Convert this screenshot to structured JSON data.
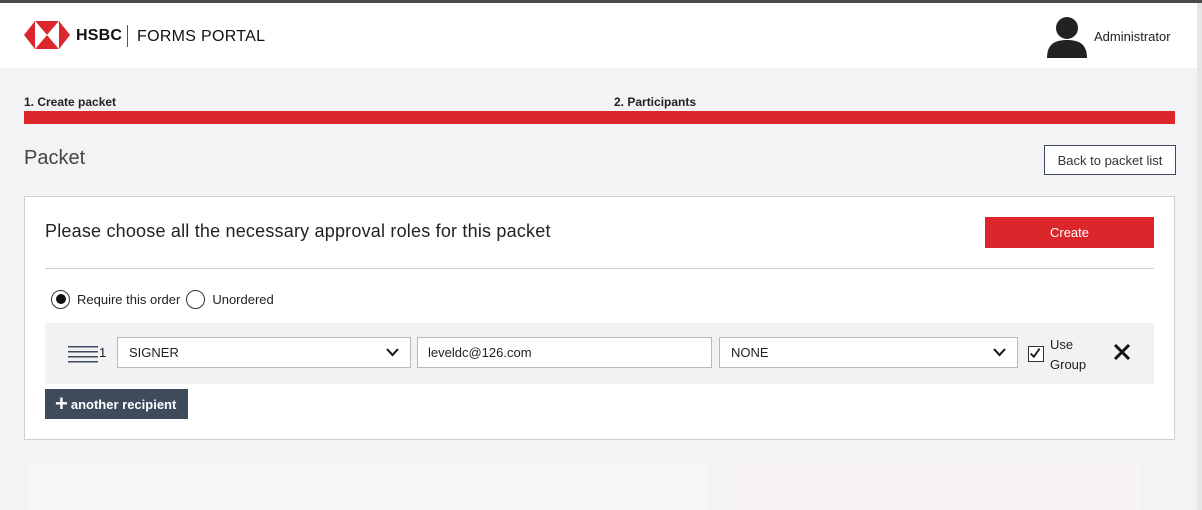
{
  "header": {
    "brand": "HSBC",
    "portal_name": "FORMS PORTAL",
    "user_name": "Administrator",
    "brand_color": "#db262c"
  },
  "steps": [
    {
      "label": "1. Create packet"
    },
    {
      "label": "2. Participants"
    }
  ],
  "page": {
    "title": "Packet",
    "back_label": "Back to packet list"
  },
  "card": {
    "title": "Please choose all the necessary approval roles for this packet",
    "create_label": "Create"
  },
  "ordering": {
    "options": [
      {
        "label": "Require this order",
        "selected": true
      },
      {
        "label": "Unordered",
        "selected": false
      }
    ]
  },
  "recipients": [
    {
      "number": "1",
      "role": "SIGNER",
      "email": "leveldc@126.com",
      "group": "NONE",
      "use_group_checked": true,
      "use_group_label": "Use Group"
    }
  ],
  "add_recipient_label": "another recipient",
  "icons": {
    "logo": "hsbc-hexagon-logo",
    "user": "user-avatar-icon",
    "drag": "drag-handle-icon",
    "chevron": "chevron-down-icon",
    "check": "checkmark-icon",
    "remove": "close-icon",
    "plus": "plus-icon"
  },
  "colors": {
    "accent": "#db262c",
    "dark_button": "#3d4b5c",
    "background": "#f3f3f5"
  }
}
